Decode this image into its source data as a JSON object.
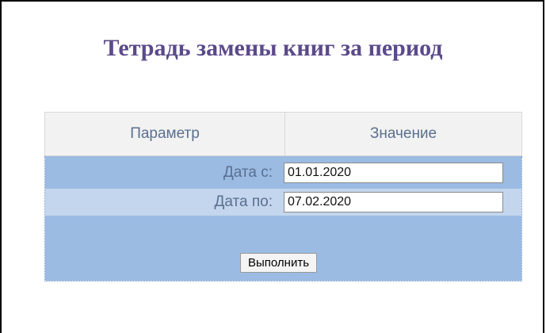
{
  "page": {
    "title": "Тетрадь замены книг за период"
  },
  "table": {
    "headers": [
      "Параметр",
      "Значение"
    ],
    "rows": [
      {
        "label": "Дата с:",
        "value": "01.01.2020"
      },
      {
        "label": "Дата по:",
        "value": "07.02.2020"
      }
    ],
    "submit_label": "Выполнить"
  },
  "colors": {
    "title": "#5b4a8a",
    "row_dark": "#9bbbe3",
    "row_light": "#c3d6ed",
    "header_bg": "#f2f2f2"
  }
}
